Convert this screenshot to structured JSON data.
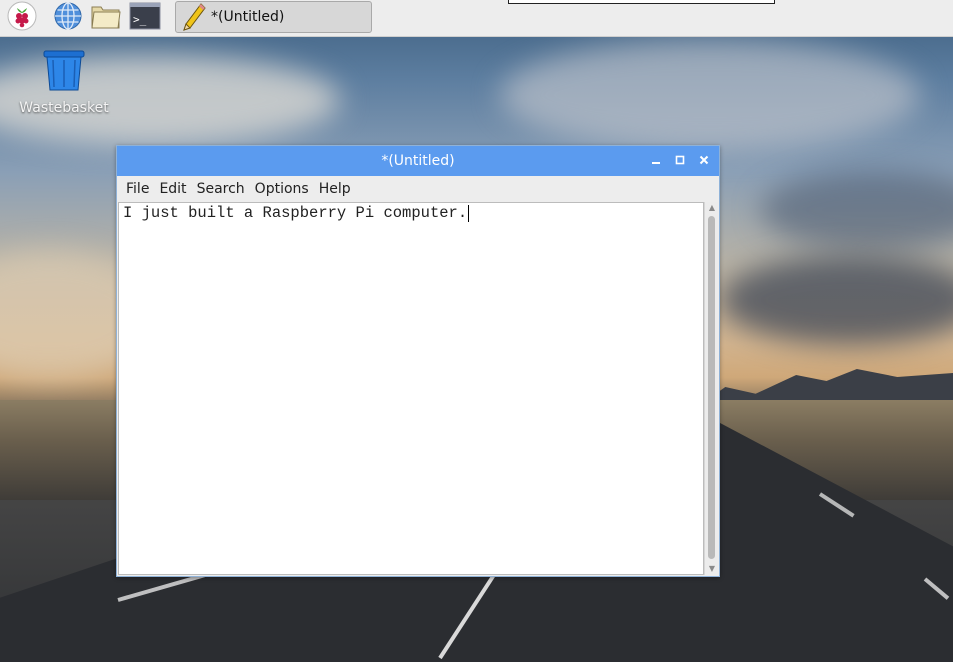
{
  "taskbar": {
    "launchers": [
      {
        "icon": "raspberry-menu-icon"
      },
      {
        "icon": "web-browser-icon"
      },
      {
        "icon": "file-manager-icon"
      },
      {
        "icon": "terminal-icon"
      }
    ],
    "task": {
      "icon": "text-editor-icon",
      "label": "*(Untitled)"
    }
  },
  "desktop": {
    "icons": [
      {
        "icon": "wastebasket-icon",
        "label": "Wastebasket"
      }
    ]
  },
  "editor": {
    "title": "*(Untitled)",
    "menu": [
      "File",
      "Edit",
      "Search",
      "Options",
      "Help"
    ],
    "content": "I just built a Raspberry Pi computer."
  },
  "colors": {
    "titlebar": "#5b9bef",
    "taskbar": "#ededed",
    "window_bg": "#ededed"
  }
}
